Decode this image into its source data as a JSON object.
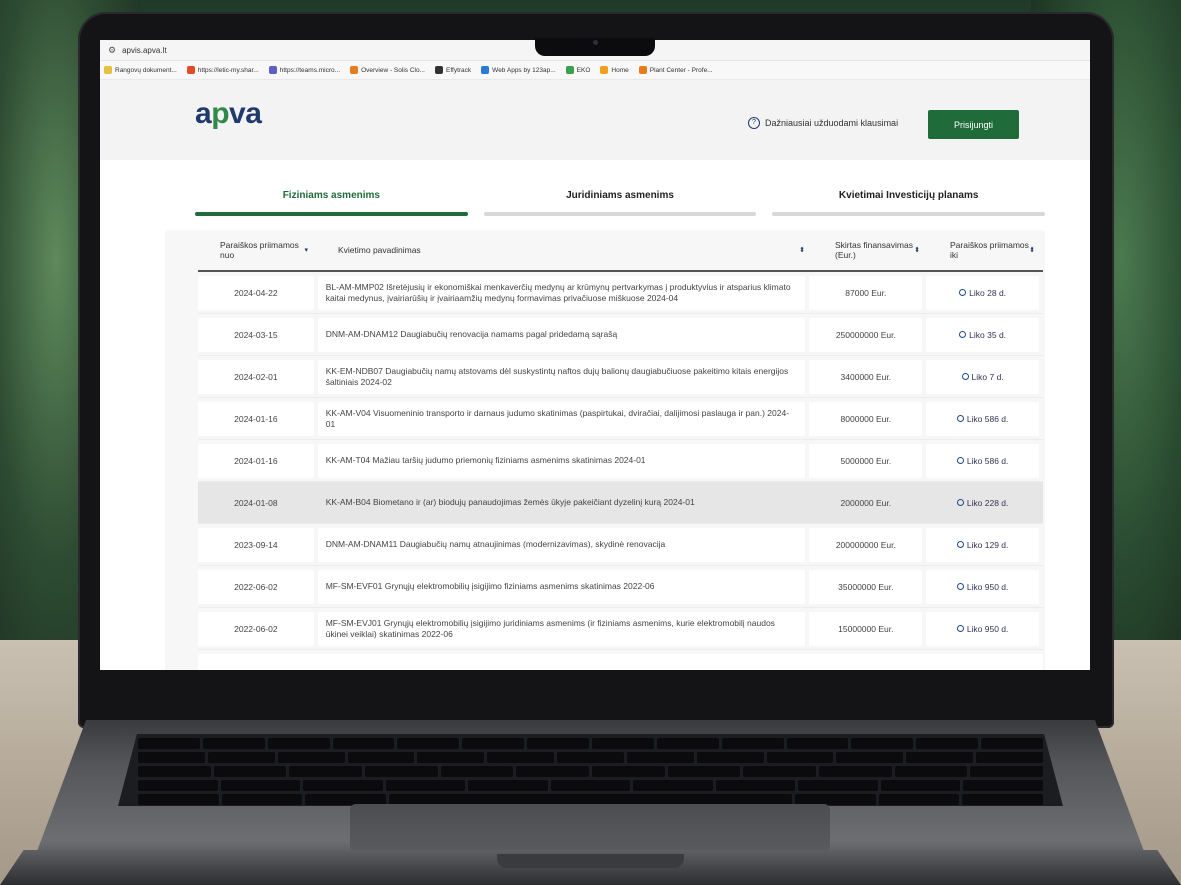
{
  "browser": {
    "url": "apvis.apva.lt",
    "bookmarks": [
      {
        "label": "Rangovų dokument...",
        "color": "#e8c040"
      },
      {
        "label": "https://letic-my.shar...",
        "color": "#e24a2a"
      },
      {
        "label": "https://teams.micro...",
        "color": "#5b5fc7"
      },
      {
        "label": "Overview - Solis Clo...",
        "color": "#e87a20"
      },
      {
        "label": "Effytrack",
        "color": "#333333"
      },
      {
        "label": "Web Apps by 123ap...",
        "color": "#2a7ad8"
      },
      {
        "label": "EKO",
        "color": "#3aa04a"
      },
      {
        "label": "Home",
        "color": "#f0a020"
      },
      {
        "label": "Plant Center - Profe...",
        "color": "#e87a20"
      }
    ]
  },
  "header": {
    "logo_a": "a",
    "logo_p": "p",
    "logo_va": "va",
    "faq_label": "Dažniausiai užduodami klausimai",
    "login_label": "Prisijungti"
  },
  "tabs": [
    {
      "label": "Fiziniams asmenims",
      "active": true
    },
    {
      "label": "Juridiniams asmenims",
      "active": false
    },
    {
      "label": "Kvietimai Investicijų planams",
      "active": false
    }
  ],
  "table": {
    "headers": {
      "date_from": "Paraiškos priimamos nuo",
      "name": "Kvietimo pavadinimas",
      "funding": "Skirtas finansavimas (Eur.)",
      "date_to": "Paraiškos priimamos iki"
    },
    "rows": [
      {
        "date": "2024-04-22",
        "name": "BL-AM-MMP02 Išretėjusių ir ekonomiškai menkaverčių medynų ar krūmynų pertvarkymas į produktyvius ir atsparius klimato kaitai medynus, įvairiarūšių ir įvairiaamžių medynų formavimas privačiuose miškuose 2024-04",
        "funding": "87000 Eur.",
        "left": "Liko 28 d."
      },
      {
        "date": "2024-03-15",
        "name": "DNM-AM-DNAM12 Daugiabučių renovacija namams pagal pridedamą sąrašą",
        "funding": "250000000 Eur.",
        "left": "Liko 35 d."
      },
      {
        "date": "2024-02-01",
        "name": "KK-EM-NDB07 Daugiabučių namų atstovams dėl suskystintų naftos dujų balionų daugiabučiuose pakeitimo kitais energijos šaltiniais 2024-02",
        "funding": "3400000 Eur.",
        "left": "Liko 7 d."
      },
      {
        "date": "2024-01-16",
        "name": "KK-AM-V04 Visuomeninio transporto ir darnaus judumo skatinimas (paspirtukai, dviračiai, dalijimosi paslauga ir pan.) 2024-01",
        "funding": "8000000 Eur.",
        "left": "Liko 586 d."
      },
      {
        "date": "2024-01-16",
        "name": "KK-AM-T04 Mažiau taršių judumo priemonių fiziniams asmenims skatinimas 2024-01",
        "funding": "5000000 Eur.",
        "left": "Liko 586 d."
      },
      {
        "date": "2024-01-08",
        "name": "KK-AM-B04 Biometano ir (ar) biodujų panaudojimas žemės ūkyje pakeičiant dyzelinį kurą 2024-01",
        "funding": "2000000 Eur.",
        "left": "Liko 228 d."
      },
      {
        "date": "2023-09-14",
        "name": "DNM-AM-DNAM11 Daugiabučių namų atnaujinimas (modernizavimas), skydinė renovacija",
        "funding": "200000000 Eur.",
        "left": "Liko 129 d."
      },
      {
        "date": "2022-06-02",
        "name": "MF-SM-EVF01 Grynųjų elektromobilių įsigijimo fiziniams asmenims skatinimas 2022-06",
        "funding": "35000000 Eur.",
        "left": "Liko 950 d."
      },
      {
        "date": "2022-06-02",
        "name": "MF-SM-EVJ01 Grynųjų elektromobilių įsigijimo juridiniams asmenims (ir fiziniams asmenims, kurie elektromobilį naudos ūkinei veiklai) skatinimas 2022-06",
        "funding": "15000000 Eur.",
        "left": "Liko 950 d."
      }
    ],
    "highlighted_row": 5
  },
  "colors": {
    "brand_green": "#1f6b3a",
    "brand_navy": "#1f3a6b"
  }
}
